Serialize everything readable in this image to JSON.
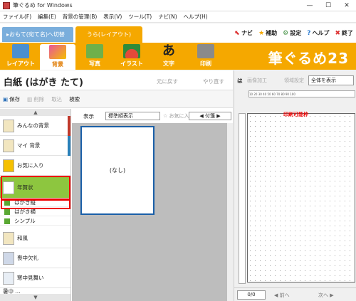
{
  "window": {
    "title": "筆ぐるめ for Windows",
    "minimize": "—",
    "maximize": "☐",
    "close": "✕"
  },
  "menu": [
    "ファイル(F)",
    "編集(E)",
    "背景の管理(B)",
    "表示(V)",
    "ツール(T)",
    "ナビ(N)",
    "ヘルプ(H)"
  ],
  "mode_tabs": {
    "omote": "▸おもて(宛て名)へ切替",
    "ura": "うら(レイアウト)"
  },
  "right_links": [
    {
      "icon": "⬉",
      "label": "ナビ"
    },
    {
      "icon": "★",
      "label": "補助"
    },
    {
      "icon": "⚙",
      "label": "設定"
    },
    {
      "icon": "?",
      "label": "ヘルプ"
    },
    {
      "icon": "✖",
      "label": "終了"
    }
  ],
  "ribbon": {
    "buttons": [
      {
        "label": "レイアウト",
        "active": false,
        "color": "#4a8fd0"
      },
      {
        "label": "背景",
        "active": true,
        "color": "#e8559a"
      },
      {
        "label": "写真",
        "active": false,
        "color": "#6fb04a"
      },
      {
        "label": "イラスト",
        "active": false,
        "color": "#e34a3a"
      },
      {
        "label": "文字",
        "active": false,
        "color": "#222222"
      },
      {
        "label": "印刷",
        "active": false,
        "color": "#8a8a8a"
      }
    ],
    "brand": "筆ぐるめ23"
  },
  "left_panel": {
    "heading": "白紙 (はがき たて)",
    "undo": "元に戻す",
    "redo": "やり直す",
    "tools": {
      "save": "保存",
      "delete": "削除",
      "import": "取込",
      "search": "検索"
    }
  },
  "categories": [
    {
      "label": "みんなの背景",
      "stripe": "#c0392b"
    },
    {
      "label": "マイ 背景",
      "stripe": "#2980b9"
    },
    {
      "label": "お気に入り",
      "stripe": ""
    },
    {
      "label": "年賀状",
      "stripe": ""
    },
    {
      "label": "和風",
      "stripe": ""
    },
    {
      "label": "喪中欠礼",
      "stripe": ""
    },
    {
      "label": "寒中見舞い",
      "stripe": ""
    },
    {
      "label": "暑中 ...",
      "stripe": ""
    }
  ],
  "subcategories": [
    "はがき縦",
    "はがき横",
    "シンプル"
  ],
  "thumb_toolbar": {
    "label": "表示",
    "sort": "標準順表示",
    "fav": "☆ お気に入",
    "page": "◀ 付箋 ▶"
  },
  "thumbnail": {
    "caption": "(なし)"
  },
  "right_panel": {
    "tool1": "は",
    "tool2": "画像加工",
    "tool3": "領域設定",
    "zoom": "全体を表示",
    "ruler": "10 20 30 40 50 60 70 80 90 100",
    "canvas_caption": "印刷可能枠",
    "page_counter": "0/0",
    "prev": "◀ 前へ",
    "next": "次へ ▶"
  }
}
